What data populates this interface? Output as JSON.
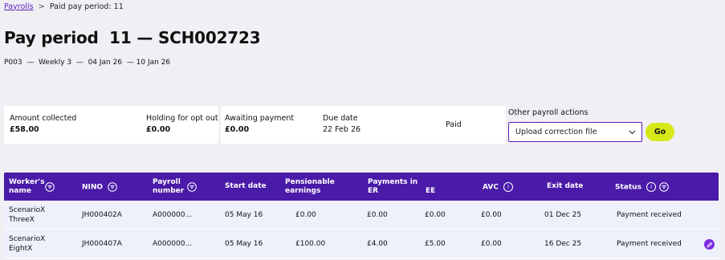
{
  "breadcrumb": {
    "root": "Payrolls",
    "separator": ">",
    "current": "Paid pay period: 11"
  },
  "page": {
    "title": "Pay period  11 — SCH002723",
    "subtitle": "P003  —  Weekly 3  —  04 Jan 26  — 10 Jan 26"
  },
  "summary": {
    "amount_collected_label": "Amount collected",
    "amount_collected_value": "£58.00",
    "holding_label": "Holding for opt out",
    "holding_value": "£0.00",
    "awaiting_label": "Awaiting payment",
    "awaiting_value": "£0.00",
    "due_label": "Due date",
    "due_value": "22 Feb 26",
    "status": "Paid"
  },
  "actions": {
    "label": "Other payroll actions",
    "selected": "Upload correction file",
    "go_label": "Go"
  },
  "table": {
    "headers": {
      "worker_name": "Worker's name",
      "worker_name_1": "Worker's",
      "worker_name_2": "name",
      "nino": "NINO",
      "payroll_1": "Payroll",
      "payroll_2": "number",
      "start_date": "Start date",
      "pensionable_1": "Pensionable",
      "pensionable_2": "earnings",
      "payments_in": "Payments in",
      "er": "ER",
      "ee": "EE",
      "avc": "AVC",
      "exit_date": "Exit date",
      "status": "Status"
    },
    "rows": [
      {
        "name_1": "ScenarioX",
        "name_2": "ThreeX",
        "nino": "JH000402A",
        "payroll": "A000000...",
        "start_date": "05 May 16",
        "pensionable": "£0.00",
        "er": "£0.00",
        "ee": "£0.00",
        "avc": "£0.00",
        "exit_date": "01 Dec 25",
        "status": "Payment received"
      },
      {
        "name_1": "ScenarioX",
        "name_2": "EightX",
        "nino": "JH000407A",
        "payroll": "A000000...",
        "start_date": "05 May 16",
        "pensionable": "£100.00",
        "er": "£4.00",
        "ee": "£5.00",
        "avc": "£0.00",
        "exit_date": "16 Dec 25",
        "status": "Payment received"
      }
    ]
  },
  "colors": {
    "header_bg": "#4a1aa8",
    "link": "#5a1fb8",
    "go_button": "#d6e818",
    "row_bg": "#eef1fb",
    "edit_button": "#7b2be2"
  },
  "icons": {
    "filter": "filter-icon",
    "info": "info-icon",
    "edit": "pencil-icon",
    "dropdown": "chevron-down-icon"
  }
}
